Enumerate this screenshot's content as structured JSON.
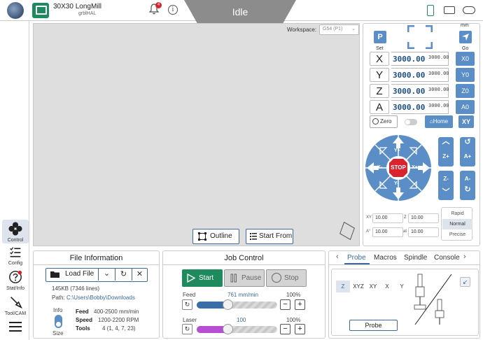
{
  "header": {
    "machine_name": "30X30 LongMill",
    "machine_firmware": "grblHAL",
    "notification_count": "4",
    "info_glyph": "i",
    "state": "Idle",
    "colors": {
      "accent": "#1f8a5e",
      "state_banner": "#8c8c8c",
      "badge": "#d9232e"
    }
  },
  "sidebar": {
    "items": [
      {
        "label": "Control",
        "icon": "control-icon"
      },
      {
        "label": "Config",
        "icon": "config-icon"
      },
      {
        "label": "Stat/Info",
        "icon": "help-icon"
      },
      {
        "label": "Tool/CAM",
        "icon": "tool-icon"
      }
    ],
    "menu_icon": "hamburger-icon"
  },
  "visualizer": {
    "workspace_label": "Workspace:",
    "workspace_value": "G54 (P1)",
    "outline_label": "Outline",
    "start_from_label": "Start From"
  },
  "dro": {
    "set_label": "Set",
    "go_label": "Go",
    "mm_label": "mm",
    "p_label": "P",
    "axes": [
      {
        "letter": "X",
        "value": "3000.00",
        "machine": "3000.00",
        "zero": "X0"
      },
      {
        "letter": "Y",
        "value": "3000.00",
        "machine": "3000.00",
        "zero": "Y0"
      },
      {
        "letter": "Z",
        "value": "3000.00",
        "machine": "3000.00",
        "zero": "Z0"
      },
      {
        "letter": "A",
        "value": "3000.00",
        "machine": "3000.00",
        "zero": "A0"
      }
    ],
    "zero_label": "Zero",
    "home_label": "Home",
    "xy_label": "XY"
  },
  "jog": {
    "y_plus": "Y+",
    "y_minus": "Y-",
    "x_plus": "X+",
    "x_minus": "X-",
    "stop": "STOP",
    "z_plus": "Z+",
    "z_minus": "Z-",
    "a_plus": "A+",
    "a_minus": "A-",
    "xy_step_label": "XY",
    "xy_step": "10.00",
    "z_step_label": "Z",
    "z_step": "10.00",
    "a_step_label": "A°",
    "a_step": "10.00",
    "at_label": "at",
    "at_value": "10.00",
    "speeds": [
      "Rapid",
      "Normal",
      "Precise"
    ],
    "selected_speed": "Normal"
  },
  "file_info": {
    "title": "File Information",
    "load_label": "Load File",
    "size_line": "145KB (7346 lines)",
    "path_label": "Path:",
    "path_value": "C:\\Users\\Bobby\\Downloads",
    "info_label": "Info",
    "size_label": "Size",
    "feed_label": "Feed",
    "feed_value": "400-2500 mm/min",
    "speed_label": "Speed",
    "speed_value": "1200-2200 RPM",
    "tools_label": "Tools",
    "tools_value": "4 (1, 4, 7, 23)"
  },
  "job_control": {
    "title": "Job Control",
    "start_label": "Start",
    "pause_label": "Pause",
    "stop_label": "Stop",
    "feed_label": "Feed",
    "feed_rate": "761 mm/min",
    "feed_pct": "100%",
    "feed_level": 0.36,
    "laser_label": "Laser",
    "laser_value": "100",
    "laser_pct": "100%",
    "laser_level": 0.36,
    "minus": "−",
    "plus": "+"
  },
  "tools_panel": {
    "tabs": [
      "Probe",
      "Macros",
      "Spindle",
      "Console"
    ],
    "active_tab": "Probe",
    "probe_options": [
      "Z",
      "XYZ",
      "XY",
      "X",
      "Y"
    ],
    "selected_option": "Z",
    "probe_button": "Probe"
  }
}
